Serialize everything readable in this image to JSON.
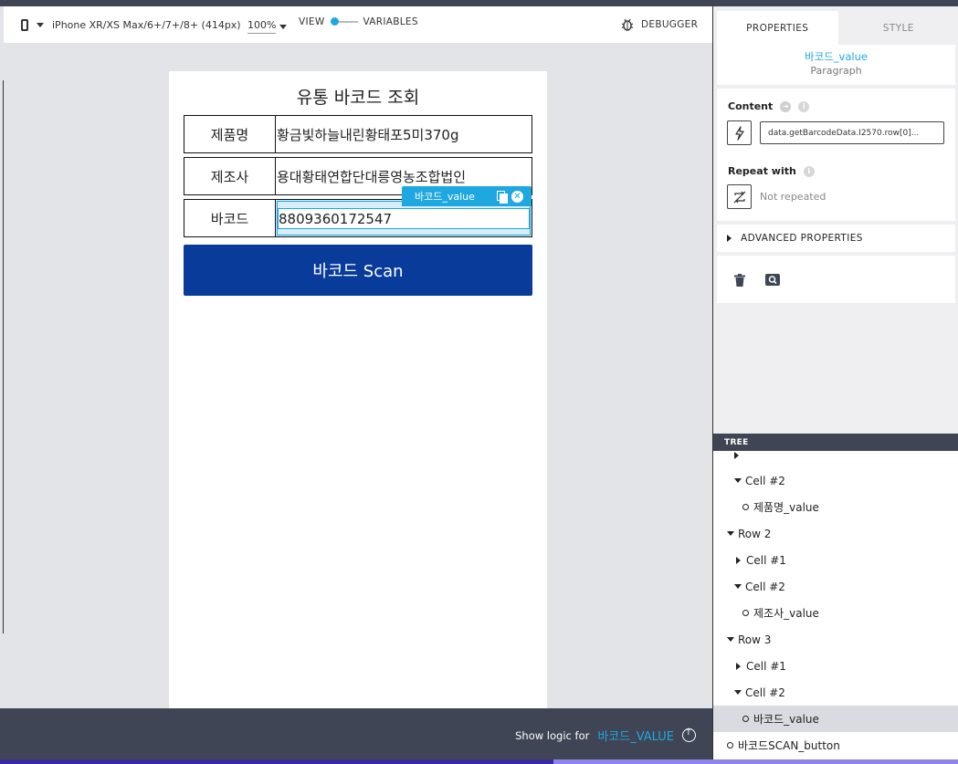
{
  "toolbar": {
    "device": "iPhone XR/XS Max/6+/7+/8+ (414px)",
    "zoom": "100%",
    "view_label": "VIEW",
    "variables_label": "VARIABLES",
    "debugger_label": "DEBUGGER"
  },
  "app": {
    "title": "유통 바코드 조회",
    "rows": [
      {
        "label": "제품명",
        "value": "황금빛하늘내린황태포5미370g"
      },
      {
        "label": "제조사",
        "value": "용대황태연합단대릉영농조합법인"
      },
      {
        "label": "바코드",
        "value": "8809360172547"
      }
    ],
    "selected_tag": "바코드_value",
    "scan_button": "바코드 Scan"
  },
  "bottom": {
    "show_logic_label": "Show logic for",
    "show_logic_var": "바코드_VALUE"
  },
  "panel": {
    "tabs": {
      "properties": "PROPERTIES",
      "style": "STYLE"
    },
    "element_name": "바코드_value",
    "element_type": "Paragraph",
    "content_label": "Content",
    "binding_value": "data.getBarcodeData.I2570.row[0]...",
    "repeat_label": "Repeat with",
    "not_repeated": "Not repeated",
    "advanced": "ADVANCED PROPERTIES"
  },
  "tree": {
    "header": "TREE",
    "items": [
      {
        "label": "Cell #2"
      },
      {
        "label": "제품명_value"
      },
      {
        "label": "Row 2"
      },
      {
        "label": "Cell #1"
      },
      {
        "label": "Cell #2"
      },
      {
        "label": "제조사_value"
      },
      {
        "label": "Row 3"
      },
      {
        "label": "Cell #1"
      },
      {
        "label": "Cell #2"
      },
      {
        "label": "바코드_value"
      },
      {
        "label": "바코드SCAN_button"
      }
    ]
  },
  "colors": {
    "accent": "#1fa8e0",
    "button": "#083b9a",
    "dark_bar": "#3f4554"
  }
}
